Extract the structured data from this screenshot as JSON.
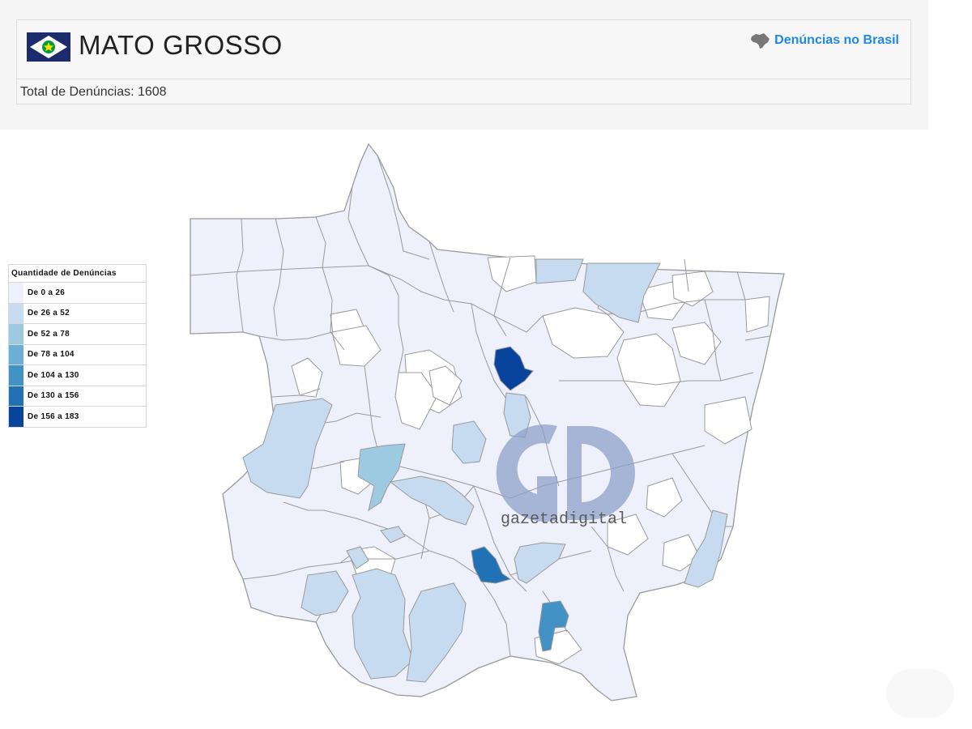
{
  "header": {
    "state_name": "MATO GROSSO",
    "brasil_link_label": "Denúncias no Brasil",
    "total_label": "Total de Denúncias: 1608"
  },
  "legend": {
    "title": "Quantidade de Denúncias",
    "ranges": [
      {
        "label": "De 0 a 26",
        "color": "#eef1fb"
      },
      {
        "label": "De 26 a 52",
        "color": "#c6dbef"
      },
      {
        "label": "De 52 a 78",
        "color": "#9ecae1"
      },
      {
        "label": "De 78 a 104",
        "color": "#6baed6"
      },
      {
        "label": "De 104 a 130",
        "color": "#4292c6"
      },
      {
        "label": "De 130 a 156",
        "color": "#2171b5"
      },
      {
        "label": "De 156 a 183",
        "color": "#08449c"
      }
    ]
  },
  "watermark": {
    "logo_letters": "GD",
    "brand": "gazetadigital"
  },
  "colors": {
    "link": "#1e88e5",
    "map_stroke": "#9a9a9a",
    "flag_blue": "#1b2b6b",
    "flag_green": "#009b3a",
    "flag_yellow": "#fedf00"
  },
  "icons": {
    "flag": "mato-grosso-flag-icon",
    "brasil_link": "brazil-map-icon"
  }
}
